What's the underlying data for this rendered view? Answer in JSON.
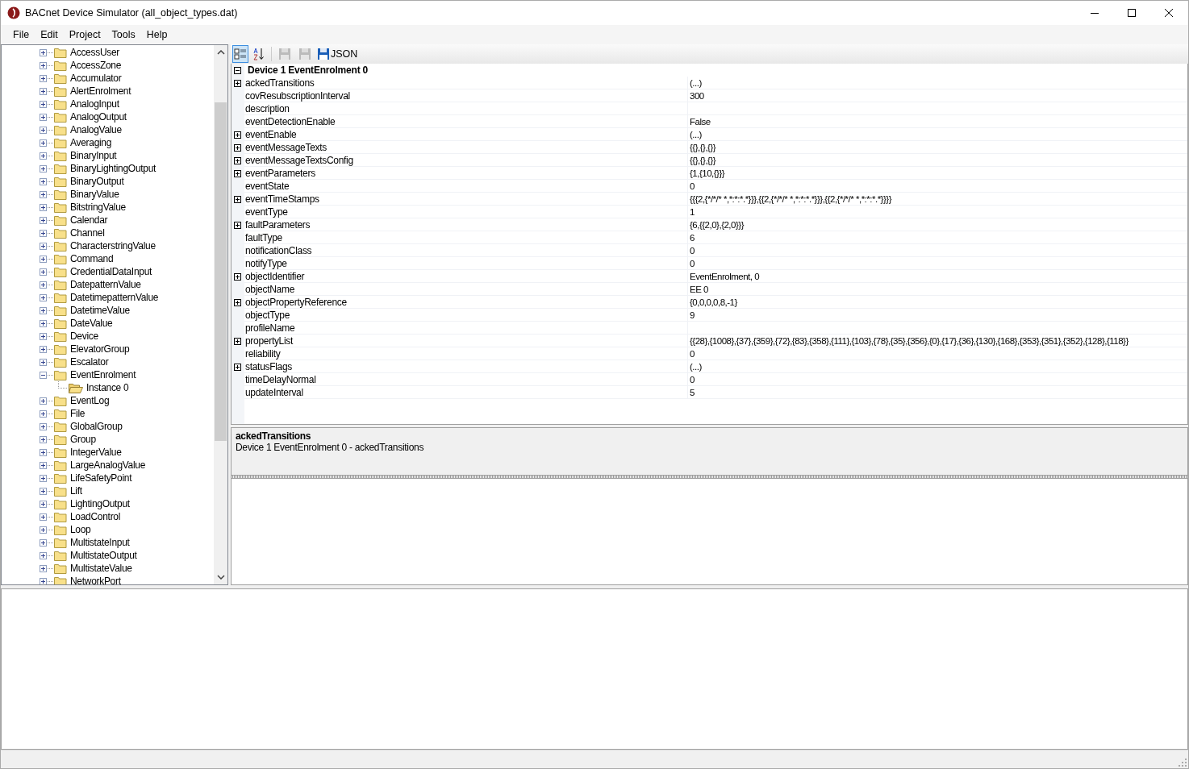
{
  "window": {
    "title": "BACnet Device Simulator (all_object_types.dat)"
  },
  "menu": [
    "File",
    "Edit",
    "Project",
    "Tools",
    "Help"
  ],
  "tree": [
    {
      "label": "AccessUser",
      "expanded": false
    },
    {
      "label": "AccessZone",
      "expanded": false
    },
    {
      "label": "Accumulator",
      "expanded": false
    },
    {
      "label": "AlertEnrolment",
      "expanded": false
    },
    {
      "label": "AnalogInput",
      "expanded": false
    },
    {
      "label": "AnalogOutput",
      "expanded": false
    },
    {
      "label": "AnalogValue",
      "expanded": false
    },
    {
      "label": "Averaging",
      "expanded": false
    },
    {
      "label": "BinaryInput",
      "expanded": false
    },
    {
      "label": "BinaryLightingOutput",
      "expanded": false
    },
    {
      "label": "BinaryOutput",
      "expanded": false
    },
    {
      "label": "BinaryValue",
      "expanded": false
    },
    {
      "label": "BitstringValue",
      "expanded": false
    },
    {
      "label": "Calendar",
      "expanded": false
    },
    {
      "label": "Channel",
      "expanded": false
    },
    {
      "label": "CharacterstringValue",
      "expanded": false
    },
    {
      "label": "Command",
      "expanded": false
    },
    {
      "label": "CredentialDataInput",
      "expanded": false
    },
    {
      "label": "DatepatternValue",
      "expanded": false
    },
    {
      "label": "DatetimepatternValue",
      "expanded": false
    },
    {
      "label": "DatetimeValue",
      "expanded": false
    },
    {
      "label": "DateValue",
      "expanded": false
    },
    {
      "label": "Device",
      "expanded": false
    },
    {
      "label": "ElevatorGroup",
      "expanded": false
    },
    {
      "label": "Escalator",
      "expanded": false
    },
    {
      "label": "EventEnrolment",
      "expanded": true,
      "children": [
        {
          "label": "Instance 0"
        }
      ]
    },
    {
      "label": "EventLog",
      "expanded": false
    },
    {
      "label": "File",
      "expanded": false
    },
    {
      "label": "GlobalGroup",
      "expanded": false
    },
    {
      "label": "Group",
      "expanded": false
    },
    {
      "label": "IntegerValue",
      "expanded": false
    },
    {
      "label": "LargeAnalogValue",
      "expanded": false
    },
    {
      "label": "LifeSafetyPoint",
      "expanded": false
    },
    {
      "label": "Lift",
      "expanded": false
    },
    {
      "label": "LightingOutput",
      "expanded": false
    },
    {
      "label": "LoadControl",
      "expanded": false
    },
    {
      "label": "Loop",
      "expanded": false
    },
    {
      "label": "MultistateInput",
      "expanded": false
    },
    {
      "label": "MultistateOutput",
      "expanded": false
    },
    {
      "label": "MultistateValue",
      "expanded": false
    },
    {
      "label": "NetworkPort",
      "expanded": false
    }
  ],
  "toolbar": {
    "json_label": "JSON"
  },
  "grid": {
    "category": "Device 1 EventEnrolment 0",
    "expanded": true,
    "rows": [
      {
        "name": "ackedTransitions",
        "value": "(...)",
        "expandable": true
      },
      {
        "name": "covResubscriptionInterval",
        "value": "300",
        "expandable": false
      },
      {
        "name": "description",
        "value": "",
        "expandable": false
      },
      {
        "name": "eventDetectionEnable",
        "value": "False",
        "expandable": false
      },
      {
        "name": "eventEnable",
        "value": "(...)",
        "expandable": true
      },
      {
        "name": "eventMessageTexts",
        "value": "{{},{},{}}",
        "expandable": true
      },
      {
        "name": "eventMessageTextsConfig",
        "value": "{{},{},{}}",
        "expandable": true
      },
      {
        "name": "eventParameters",
        "value": "{1,{10,{}}}",
        "expandable": true
      },
      {
        "name": "eventState",
        "value": "0",
        "expandable": false
      },
      {
        "name": "eventTimeStamps",
        "value": "{{{2,{*/*/* *,*:*:*.*}}},{{2,{*/*/* *,*:*:*.*}}},{{2,{*/*/* *,*:*:*.*}}}}",
        "expandable": true
      },
      {
        "name": "eventType",
        "value": "1",
        "expandable": false
      },
      {
        "name": "faultParameters",
        "value": "{6,{{2,0},{2,0}}}",
        "expandable": true
      },
      {
        "name": "faultType",
        "value": "6",
        "expandable": false
      },
      {
        "name": "notificationClass",
        "value": "0",
        "expandable": false
      },
      {
        "name": "notifyType",
        "value": "0",
        "expandable": false
      },
      {
        "name": "objectIdentifier",
        "value": "EventEnrolment, 0",
        "expandable": true
      },
      {
        "name": "objectName",
        "value": "EE 0",
        "expandable": false
      },
      {
        "name": "objectPropertyReference",
        "value": "{0,0,0,0,8,-1}",
        "expandable": true
      },
      {
        "name": "objectType",
        "value": "9",
        "expandable": false
      },
      {
        "name": "profileName",
        "value": "",
        "expandable": false
      },
      {
        "name": "propertyList",
        "value": "{{28},{1008},{37},{359},{72},{83},{358},{111},{103},{78},{35},{356},{0},{17},{36},{130},{168},{353},{351},{352},{128},{118}}",
        "expandable": true
      },
      {
        "name": "reliability",
        "value": "0",
        "expandable": false
      },
      {
        "name": "statusFlags",
        "value": "(...)",
        "expandable": true
      },
      {
        "name": "timeDelayNormal",
        "value": "0",
        "expandable": false
      },
      {
        "name": "updateInterval",
        "value": "5",
        "expandable": false
      }
    ]
  },
  "help": {
    "title": "ackedTransitions",
    "text": "Device 1 EventEnrolment 0 - ackedTransitions"
  }
}
